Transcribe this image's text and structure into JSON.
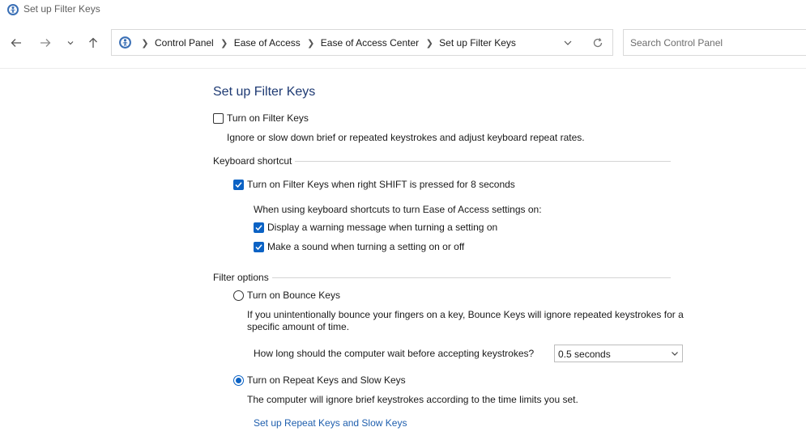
{
  "window": {
    "title": "Set up Filter Keys"
  },
  "nav": {
    "breadcrumbs": [
      "Control Panel",
      "Ease of Access",
      "Ease of Access Center",
      "Set up Filter Keys"
    ],
    "search_placeholder": "Search Control Panel"
  },
  "page": {
    "title": "Set up Filter Keys",
    "turn_on_filter_keys": {
      "label": "Turn on Filter Keys",
      "checked": false
    },
    "turn_on_description": "Ignore or slow down brief or repeated keystrokes and adjust keyboard repeat rates.",
    "keyboard_shortcut": {
      "heading": "Keyboard shortcut",
      "shift_option": {
        "label": "Turn on Filter Keys when right SHIFT is pressed for 8 seconds",
        "checked": true
      },
      "subheading": "When using keyboard shortcuts to turn Ease of Access settings on:",
      "warning_option": {
        "label": "Display a warning message when turning a setting on",
        "checked": true
      },
      "sound_option": {
        "label": "Make a sound when turning a setting on or off",
        "checked": true
      }
    },
    "filter_options": {
      "heading": "Filter options",
      "bounce_keys": {
        "label": "Turn on Bounce Keys",
        "selected": false,
        "description_line1": "If you unintentionally bounce your fingers on a key, Bounce Keys will ignore repeated keystrokes for a",
        "description_line2": "specific amount of time.",
        "wait_question": "How long should the computer wait before accepting keystrokes?",
        "wait_value": "0.5 seconds"
      },
      "repeat_slow_keys": {
        "label": "Turn on Repeat Keys and Slow Keys",
        "selected": true,
        "description": "The computer will ignore brief keystrokes according to the time limits you set.",
        "setup_link": "Set up Repeat Keys and Slow Keys"
      }
    }
  },
  "colors": {
    "accent": "#0b62c4",
    "title": "#1e3a73",
    "link": "#1f5fae"
  }
}
